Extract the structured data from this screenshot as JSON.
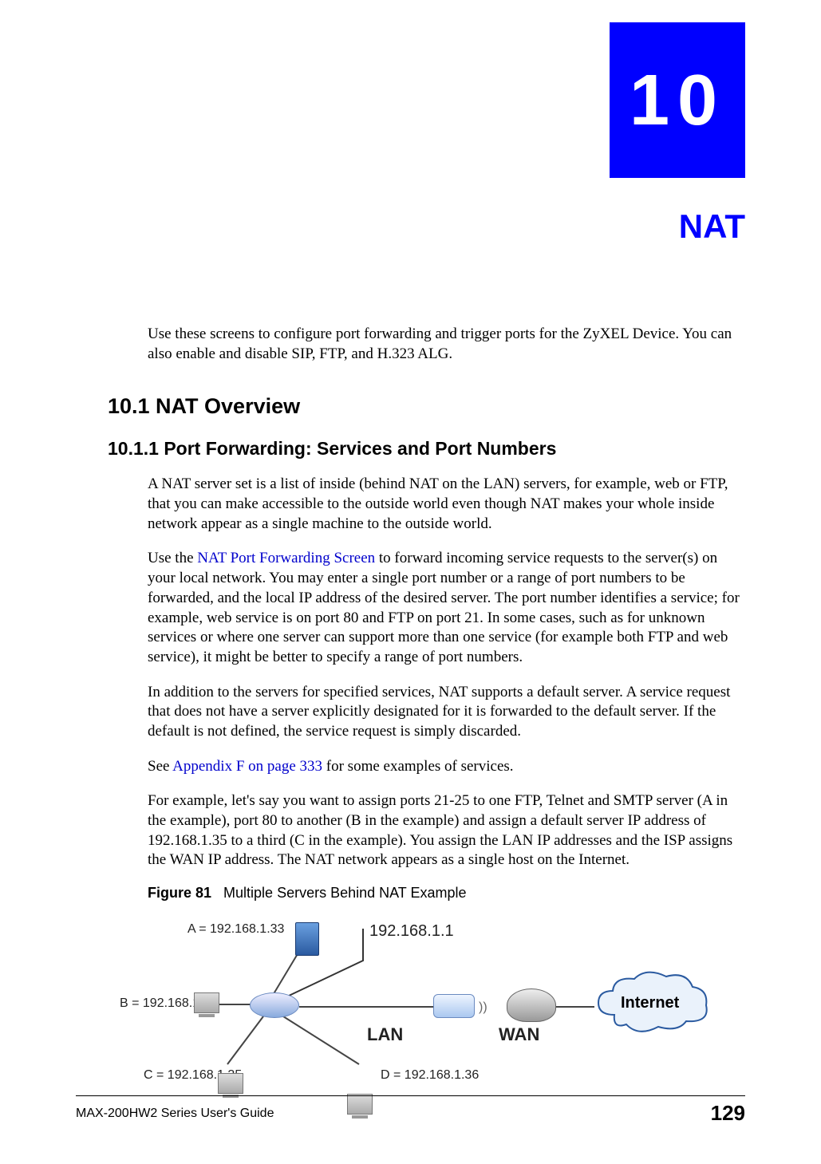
{
  "chapter": {
    "number": "10",
    "title": "NAT"
  },
  "intro": "Use these screens to configure port forwarding and trigger ports for the ZyXEL Device. You can also enable and disable SIP, FTP, and H.323 ALG.",
  "section": {
    "num_title": "10.1  NAT Overview",
    "sub_num_title": "10.1.1  Port Forwarding: Services and Port Numbers",
    "para1": "A NAT server set is a list of inside (behind NAT on the LAN) servers, for example, web or FTP, that you can make accessible to the outside world even though NAT makes your whole inside network appear as a single machine to the outside world.",
    "para2_pre": "Use the ",
    "para2_link": "NAT Port Forwarding Screen",
    "para2_post": " to forward incoming service requests to the server(s) on your local network. You may enter a single port number or a range of port numbers to be forwarded, and the local IP address of the desired server. The port number identifies a service; for example, web service is on port 80 and FTP on port 21. In some cases, such as for unknown services or where one server can support more than one service (for example both FTP and web service), it might be better to specify a range of port numbers.",
    "para3": "In addition to the servers for specified services, NAT supports a default server. A service request that does not have a server explicitly designated for it is forwarded to the default server. If the default is not defined, the service request is simply discarded.",
    "para4_pre": "See ",
    "para4_link": "Appendix F on page 333",
    "para4_post": " for some examples of services.",
    "para5": "For example, let's say you want to assign ports 21-25 to one FTP, Telnet and SMTP server (A in the example), port 80 to another (B in the example) and assign a default server IP address of 192.168.1.35 to a third (C in the example). You assign the LAN IP addresses and the ISP assigns the WAN IP address. The NAT network appears as a single host on the Internet."
  },
  "figure": {
    "label": "Figure 81",
    "caption": "Multiple Servers Behind NAT Example",
    "labels": {
      "A": "A = 192.168.1.33",
      "B": "B = 192.168.1.34",
      "C": "C = 192.168.1.35",
      "D": "D = 192.168.1.36",
      "router": "192.168.1.1",
      "LAN": "LAN",
      "WAN": "WAN",
      "Internet": "Internet"
    }
  },
  "footer": {
    "guide": "MAX-200HW2 Series User's Guide",
    "page": "129"
  }
}
